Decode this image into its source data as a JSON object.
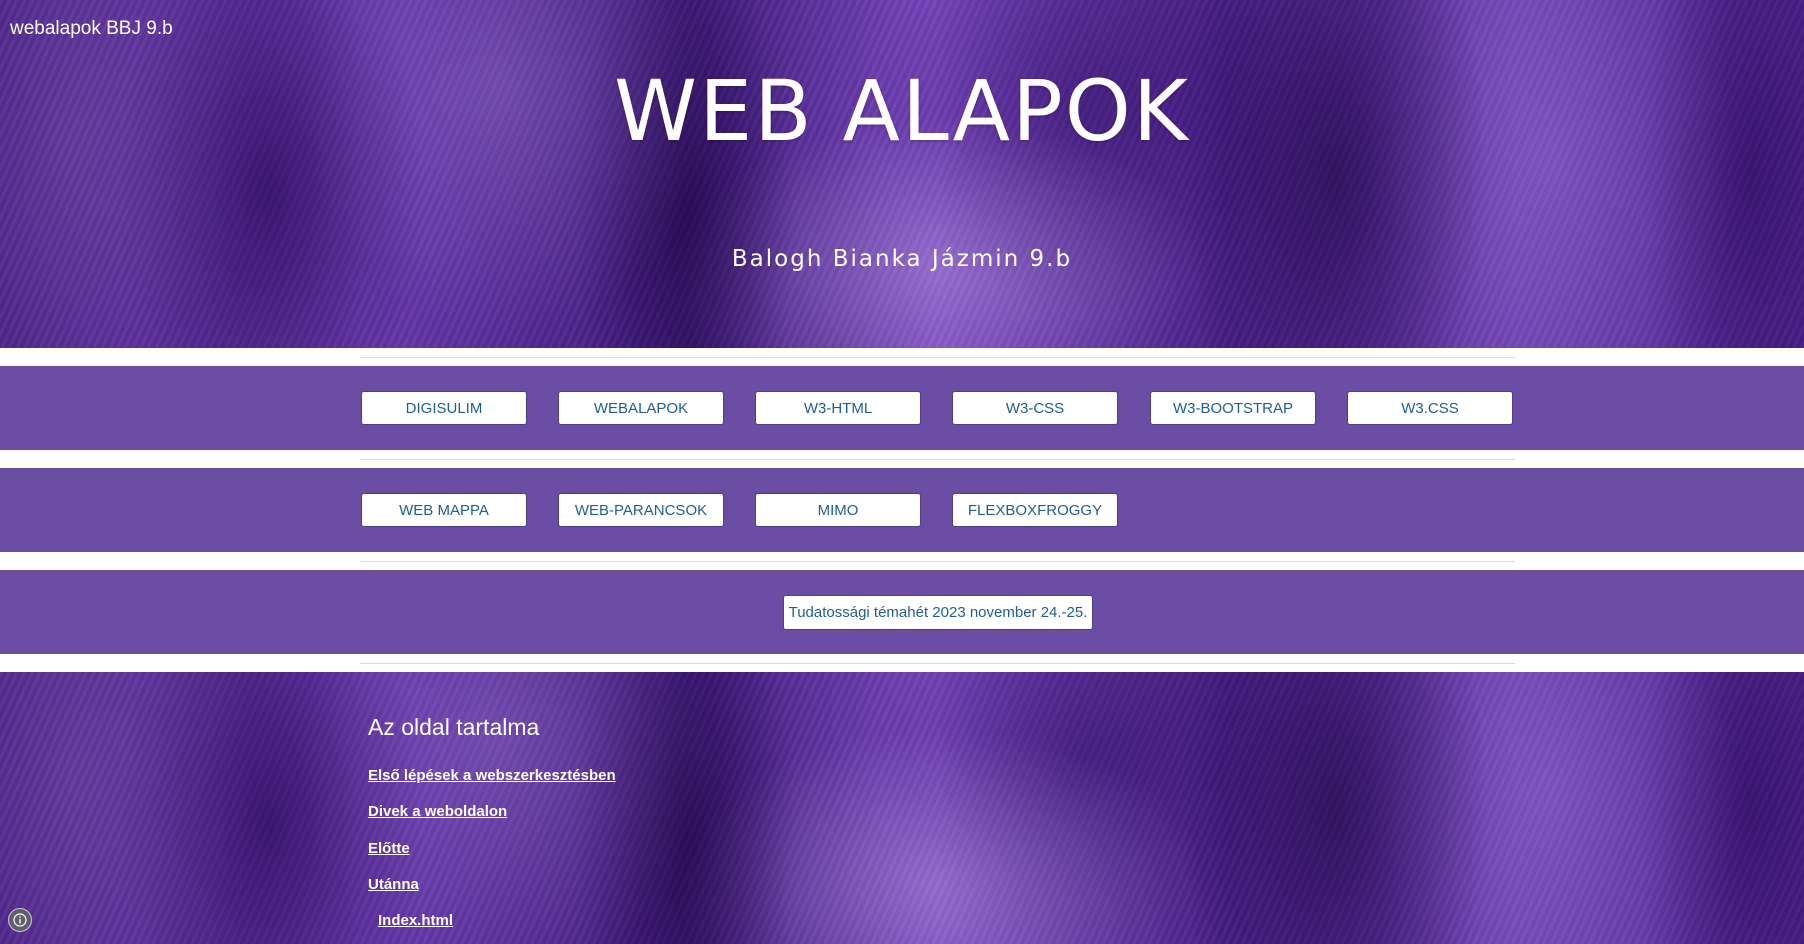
{
  "site_name": "webalapok BBJ 9.b",
  "hero": {
    "title": "WEB ALAPOK",
    "subtitle": "Balogh Bianka Jázmin 9.b"
  },
  "nav_row1": [
    "DIGISULIM",
    "WEBALAPOK",
    "W3-HTML",
    "W3-CSS",
    "W3-BOOTSTRAP",
    "W3.CSS"
  ],
  "nav_row2": [
    "WEB MAPPA",
    "WEB-PARANCSOK",
    "MIMO",
    "FLEXBOXFROGGY"
  ],
  "notice_button": "Tudatossági témahét 2023 november 24.-25.",
  "toc": {
    "heading": "Az oldal tartalma",
    "links": [
      "Első lépések a webszerkesztésben",
      "Divek a weboldalon",
      "Előtte",
      "Utánna",
      "Index.html"
    ]
  },
  "icons": {
    "info": "info-icon"
  },
  "colors": {
    "band": "#6b4ea3",
    "button_text": "#1f5f8f",
    "hero_bg": "#5a2a9c"
  }
}
